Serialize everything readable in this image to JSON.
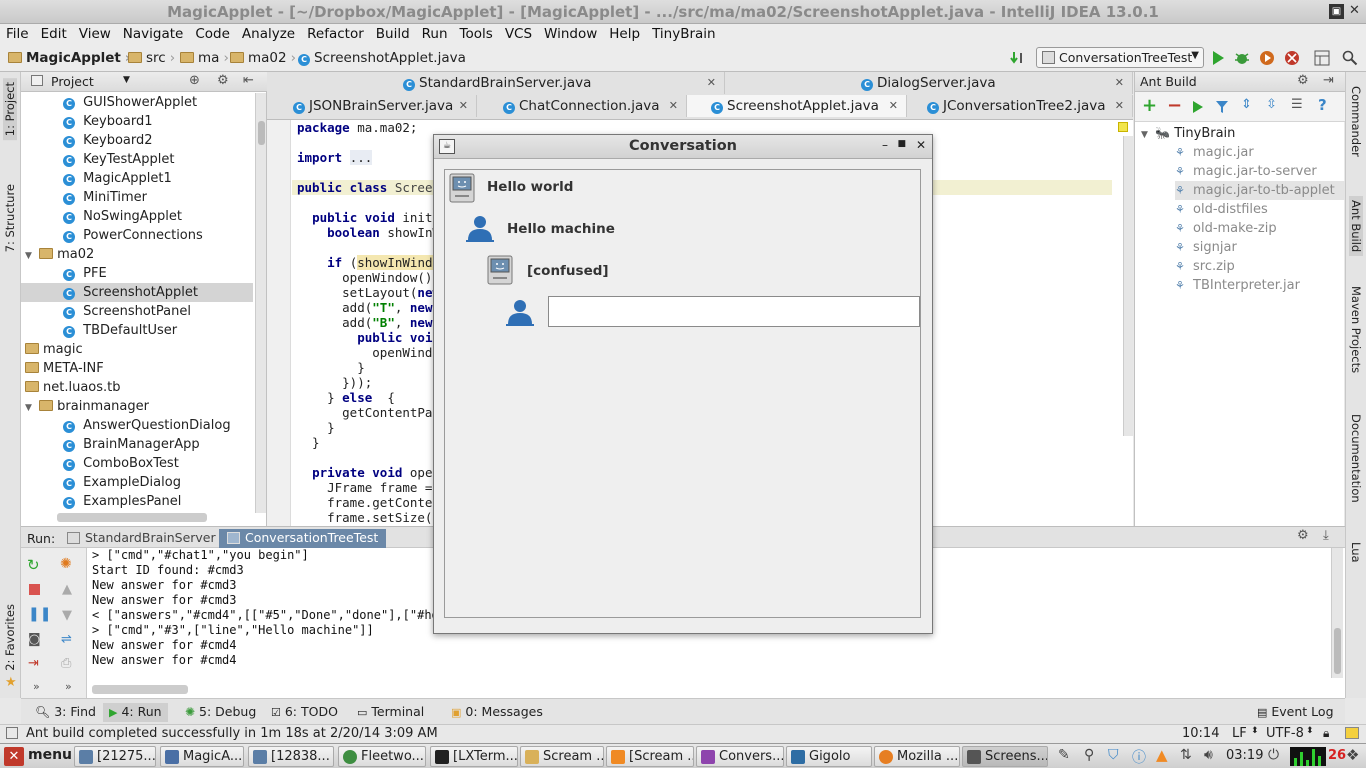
{
  "window": {
    "title": "MagicApplet - [~/Dropbox/MagicApplet] - [MagicApplet] - .../src/ma/ma02/ScreenshotApplet.java - IntelliJ IDEA 13.0.1"
  },
  "menu": [
    "File",
    "Edit",
    "View",
    "Navigate",
    "Code",
    "Analyze",
    "Refactor",
    "Build",
    "Run",
    "Tools",
    "VCS",
    "Window",
    "Help",
    "TinyBrain"
  ],
  "breadcrumb": [
    "MagicApplet",
    "src",
    "ma",
    "ma02",
    "ScreenshotApplet.java"
  ],
  "run_config": "ConversationTreeTest",
  "left_stripe": [
    "1: Project",
    "7: Structure",
    "2: Favorites"
  ],
  "project": {
    "header": "Project",
    "items": [
      {
        "label": "GUIShowerApplet",
        "type": "class"
      },
      {
        "label": "Keyboard1",
        "type": "class"
      },
      {
        "label": "Keyboard2",
        "type": "class"
      },
      {
        "label": "KeyTestApplet",
        "type": "class"
      },
      {
        "label": "MagicApplet1",
        "type": "class"
      },
      {
        "label": "MiniTimer",
        "type": "class"
      },
      {
        "label": "NoSwingApplet",
        "type": "class"
      },
      {
        "label": "PowerConnections",
        "type": "class"
      },
      {
        "label": "ma02",
        "type": "folder"
      },
      {
        "label": "PFE",
        "type": "class"
      },
      {
        "label": "ScreenshotApplet",
        "type": "class"
      },
      {
        "label": "ScreenshotPanel",
        "type": "class"
      },
      {
        "label": "TBDefaultUser",
        "type": "class"
      },
      {
        "label": "magic",
        "type": "folder"
      },
      {
        "label": "META-INF",
        "type": "folder"
      },
      {
        "label": "net.luaos.tb",
        "type": "folder"
      },
      {
        "label": "brainmanager",
        "type": "folder"
      },
      {
        "label": "AnswerQuestionDialog",
        "type": "class"
      },
      {
        "label": "BrainManagerApp",
        "type": "class"
      },
      {
        "label": "ComboBoxTest",
        "type": "class"
      },
      {
        "label": "ExampleDialog",
        "type": "class"
      },
      {
        "label": "ExamplesPanel",
        "type": "class"
      }
    ]
  },
  "editor_tabs": {
    "row1": [
      "StandardBrainServer.java",
      "DialogServer.java"
    ],
    "row2": [
      "JSONBrainServer.java",
      "ChatConnection.java",
      "ScreenshotApplet.java",
      "JConversationTree2.java"
    ]
  },
  "code_lines": [
    "package ma.ma02;",
    "",
    "import ...",
    "",
    "public class Screens",
    "",
    "  public void init()",
    "    boolean showInWi",
    "",
    "    if (showInWindow",
    "      openWindow();",
    "      setLayout(new",
    "      add(\"T\", new J",
    "      add(\"B\", new J",
    "        public void",
    "          openWindo",
    "        }",
    "      }));",
    "    } else  {",
    "      getContentPane",
    "    }",
    "  }",
    "",
    "  private void openW",
    "    JFrame frame = n",
    "    frame.getContent",
    "    frame.setSize(40"
  ],
  "ant": {
    "header": "Ant Build",
    "project": "TinyBrain",
    "targets": [
      "magic.jar",
      "magic.jar-to-server",
      "magic.jar-to-tb-applet",
      "old-distfiles",
      "old-make-zip",
      "signjar",
      "src.zip",
      "TBInterpreter.jar"
    ]
  },
  "right_stripe": [
    "Commander",
    "Ant Build",
    "Maven Projects",
    "Documentation",
    "Lua"
  ],
  "run": {
    "label": "Run:",
    "tabs": [
      "StandardBrainServer",
      "ConversationTreeTest"
    ],
    "console": [
      "> [\"cmd\",\"#chat1\",\"you begin\"]",
      "Start ID found: #cmd3",
      "New answer for #cmd3",
      "New answer for #cmd3",
      "< [\"answers\",\"#cmd4\",[[\"#5\",\"Done\",\"done\"],[\"#hol",
      "> [\"cmd\",\"#3\",[\"line\",\"Hello machine\"]]",
      "New answer for #cmd4",
      "New answer for #cmd4"
    ]
  },
  "bottom_tabs": [
    "3: Find",
    "4: Run",
    "5: Debug",
    "6: TODO",
    "Terminal",
    "0: Messages",
    "Event Log"
  ],
  "status": {
    "message": "Ant build completed successfully in 1m 18s at 2/20/14 3:09 AM",
    "position": "10:14",
    "line_sep": "LF",
    "encoding": "UTF-8"
  },
  "dialog": {
    "title": "Conversation",
    "messages": [
      {
        "speaker": "machine",
        "text": "Hello world"
      },
      {
        "speaker": "user",
        "text": "Hello machine"
      },
      {
        "speaker": "machine",
        "text": "[confused]"
      }
    ],
    "input_value": ""
  },
  "taskbar": {
    "menu": "menu",
    "tasks": [
      "[21275...",
      "MagicA...",
      "[12838...",
      "Fleetwo...",
      "[LXTerm...",
      "Scream ...",
      "[Scream ...",
      "Convers...",
      "Gigolo",
      "Mozilla ...",
      "Screens..."
    ],
    "clock": "03:19",
    "cpu": "26"
  },
  "colors": {
    "accent": "#2b8fd6",
    "run_tab": "#6b88a8",
    "green": "#2fa52f"
  }
}
